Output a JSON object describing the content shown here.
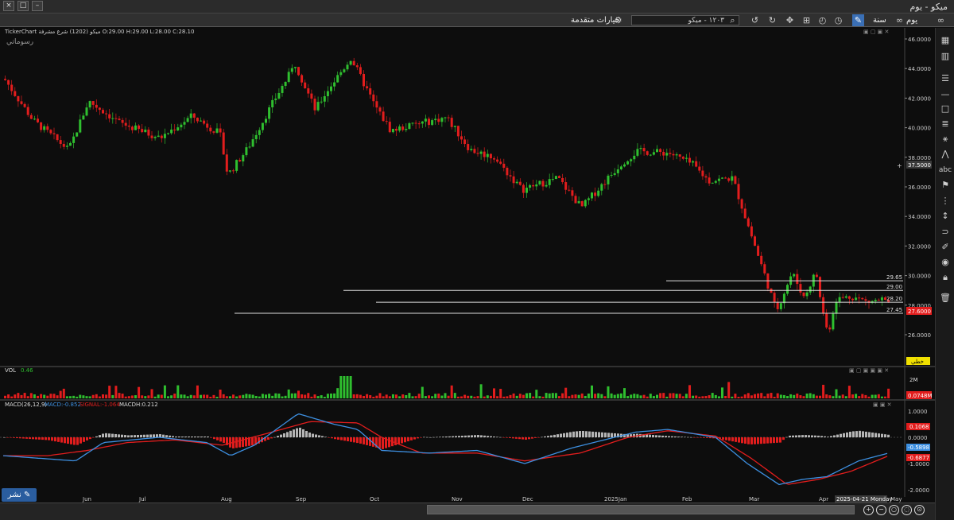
{
  "window": {
    "title": "ميكو - يوم"
  },
  "toolbar": {
    "period_day": "يوم",
    "period_year": "سنة",
    "search_value": "١٢٠٣ - ميكو",
    "advanced_options": "خيارات متقدمة"
  },
  "chart": {
    "header_text": "TickerChart ميكو (1202) شرع مشرفة  O:29.00  H:29.00  L:28.00  C:28.10",
    "drawings_label": "رسوماتي",
    "price_axis": [
      "46.0000",
      "44.0000",
      "42.0000",
      "40.0000",
      "38.0000",
      "36.0000",
      "34.0000",
      "32.0000",
      "30.0000",
      "28.0000",
      "26.0000"
    ],
    "crosshair_price": "37.5000",
    "last_price": "27.6000",
    "level_labels": [
      "29.65",
      "29.00",
      "28.20",
      "27.45"
    ],
    "mini_button": "خطي",
    "vol_label": "VOL",
    "vol_value": "0.46",
    "vol_axis": "2M",
    "vol_last": "0.0748M",
    "macd_label": "MACD(26,12,9)",
    "macd_value": "MACD:-0.852",
    "signal_value": "SIGNAL:-1.064",
    "macdh_value": "MACDH:0.212",
    "macd_axis": [
      "1.0000",
      "0.0000",
      "-1.0000",
      "-2.0000"
    ],
    "macd_tag1": "0.1068",
    "macd_tag2": "-0.5898",
    "macd_tag3": "-0.6877",
    "months": [
      "Jun",
      "Jul",
      "Aug",
      "Sep",
      "Oct",
      "Nov",
      "Dec",
      "2025Jan",
      "Feb",
      "Mar",
      "Apr",
      "May"
    ],
    "date_tooltip": "2025-04-21 Monday"
  },
  "colors": {
    "up": "#2fbf2f",
    "down": "#e21d1d",
    "macd_line": "#3d8fe0",
    "signal_line": "#e21d1d",
    "hist_pos": "#b5b5b5",
    "hist_neg": "#e21d1d"
  },
  "bottom": {
    "draw_label": "نشر"
  },
  "chart_data": {
    "type": "candlestick",
    "title": "",
    "series": [
      {
        "name": "close",
        "x": [
          "Jun",
          "Jul",
          "Aug",
          "Sep",
          "Oct",
          "Nov",
          "Dec",
          "2025Jan",
          "Feb",
          "Mar",
          "Apr",
          "May"
        ],
        "values": [
          42.0,
          40.5,
          37.5,
          43.5,
          41.0,
          38.5,
          36.0,
          37.5,
          37.5,
          29.0,
          27.5,
          28.1
        ]
      }
    ],
    "ylim": [
      25,
      46.5
    ]
  }
}
